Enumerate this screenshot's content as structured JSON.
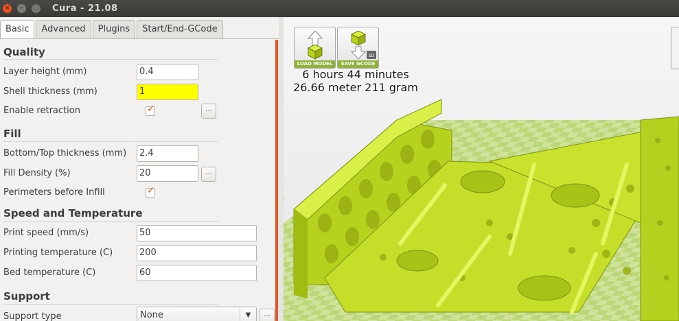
{
  "window": {
    "title": "Cura - 21.08"
  },
  "tabs": [
    {
      "label": "Basic",
      "active": true
    },
    {
      "label": "Advanced",
      "active": false
    },
    {
      "label": "Plugins",
      "active": false
    },
    {
      "label": "Start/End-GCode",
      "active": false
    }
  ],
  "quality": {
    "heading": "Quality",
    "layer_height_label": "Layer height (mm)",
    "layer_height": "0.4",
    "shell_thickness_label": "Shell thickness (mm)",
    "shell_thickness": "1",
    "retraction_label": "Enable retraction",
    "retraction_checked": true,
    "more_label": "..."
  },
  "fill": {
    "heading": "Fill",
    "bottom_top_label": "Bottom/Top thickness (mm)",
    "bottom_top": "2.4",
    "density_label": "Fill Density (%)",
    "density": "20",
    "perimeters_label": "Perimeters before Infill",
    "perimeters_checked": true,
    "more_label": "..."
  },
  "speed": {
    "heading": "Speed and Temperature",
    "print_speed_label": "Print speed (mm/s)",
    "print_speed": "50",
    "print_temp_label": "Printing temperature (C)",
    "print_temp": "200",
    "bed_temp_label": "Bed temperature (C)",
    "bed_temp": "60"
  },
  "support": {
    "heading": "Support",
    "type_label": "Support type",
    "type_value": "None",
    "more_label": "..."
  },
  "viewport": {
    "load_model_label": "LOAD MODEL",
    "save_gcode_label": "SAVE GCODE",
    "sd_label": "SD",
    "print_time": "6 hours 44 minutes",
    "print_material": "26.66 meter 211 gram"
  },
  "colors": {
    "accent": "#e95420",
    "model": "#c8e632",
    "highlight": "#ffff00"
  }
}
